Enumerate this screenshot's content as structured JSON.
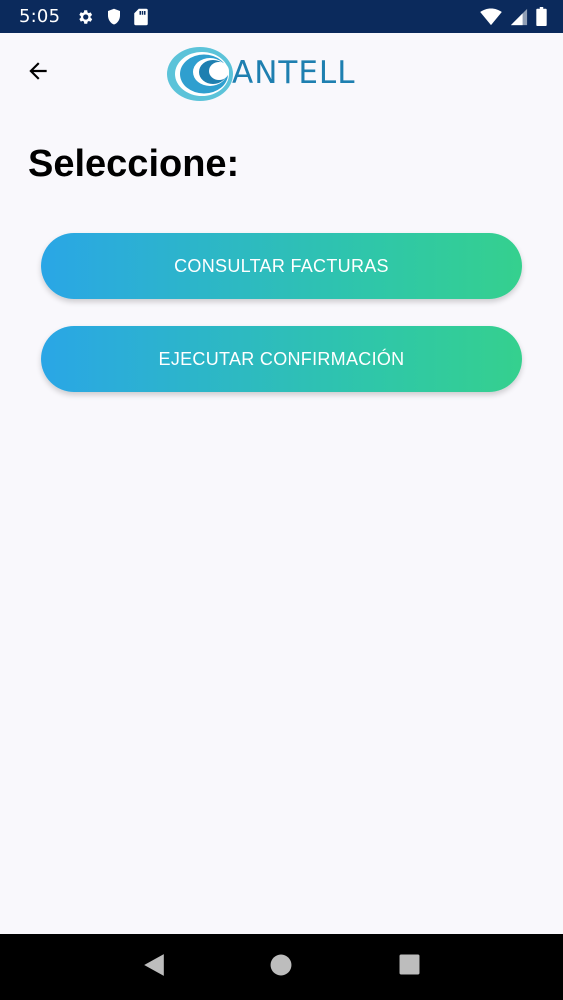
{
  "status_bar": {
    "time": "5:05",
    "icons_left": [
      "settings-icon",
      "shield-icon",
      "sd-card-icon"
    ],
    "icons_right": [
      "wifi-icon",
      "signal-icon",
      "battery-icon"
    ]
  },
  "app_bar": {
    "back_icon": "arrow-left-icon",
    "logo_text": "ANTELL"
  },
  "main": {
    "title": "Seleccione:",
    "buttons": [
      {
        "label": "CONSULTAR FACTURAS"
      },
      {
        "label": "EJECUTAR CONFIRMACIÓN"
      }
    ]
  },
  "nav_bar": {
    "icons": [
      "nav-back-icon",
      "nav-home-icon",
      "nav-recents-icon"
    ]
  },
  "colors": {
    "status_bar": "#0b2a5c",
    "background": "#f9f8fc",
    "button_gradient_start": "#2aa6e6",
    "button_gradient_end": "#35d08e",
    "logo": "#1e7fb0"
  }
}
